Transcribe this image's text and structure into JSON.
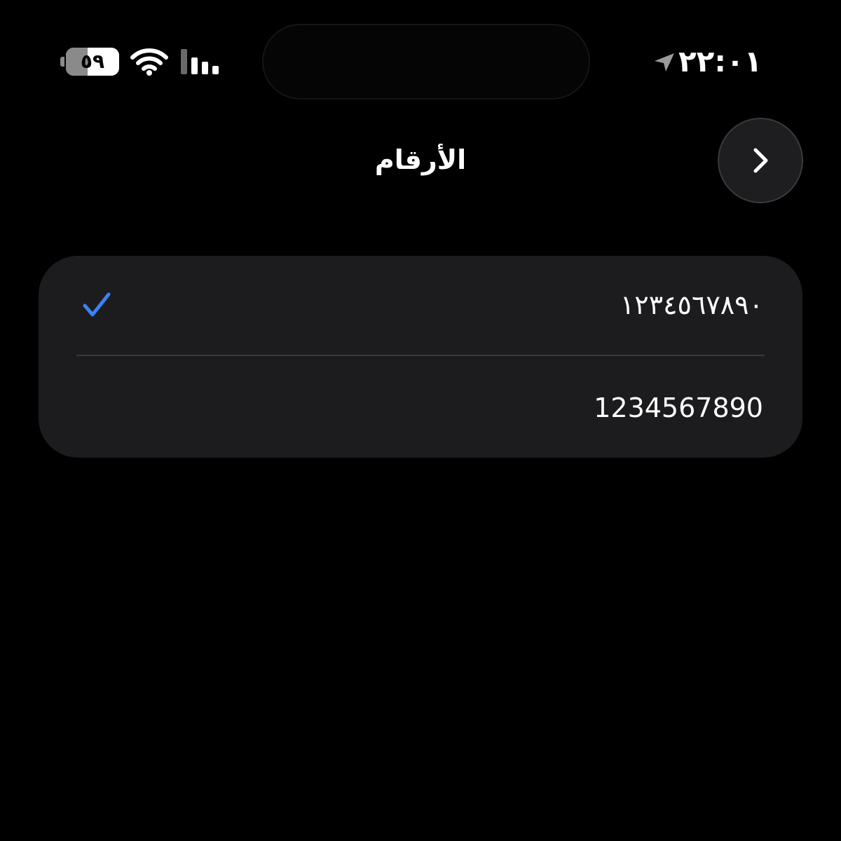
{
  "status_bar": {
    "time": "٢٢:٠١",
    "battery_level": "٥٩",
    "battery_fraction": 0.59,
    "icons": [
      "location-icon",
      "wifi-icon",
      "signal-icon",
      "battery-icon"
    ]
  },
  "nav": {
    "title": "الأرقام",
    "back_icon": "chevron-right-icon"
  },
  "options": [
    {
      "label": "١٢٣٤٥٦٧٨٩٠",
      "selected": true
    },
    {
      "label": "1234567890",
      "selected": false
    }
  ],
  "colors": {
    "background": "#000000",
    "card": "#1c1c1e",
    "separator": "#3a3a3c",
    "accent": "#3a82f7",
    "text": "#ffffff"
  }
}
